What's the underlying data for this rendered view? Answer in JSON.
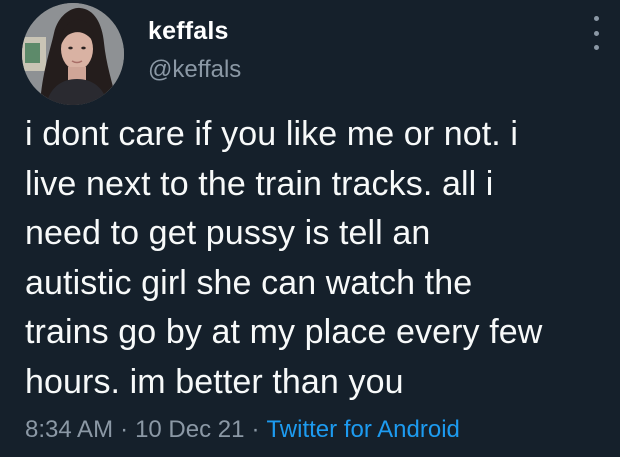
{
  "colors": {
    "background": "#15202b",
    "text_primary": "#f7f9f9",
    "text_secondary": "#8b98a5",
    "link": "#1d9bf0"
  },
  "author": {
    "display_name": "keffals",
    "handle": "@keffals",
    "avatar_icon": "profile-avatar"
  },
  "menu_icon": "more-vertical-icon",
  "tweet": {
    "lines": [
      "i dont care if you like me or not. i",
      "live next to the train tracks. all i",
      "need to get pussy is tell an",
      "autistic girl she can watch the",
      "trains go by at my place every few",
      "hours. im better than you"
    ]
  },
  "meta": {
    "time": "8:34 AM",
    "separator": "·",
    "date": "10 Dec 21",
    "source": "Twitter for Android"
  }
}
